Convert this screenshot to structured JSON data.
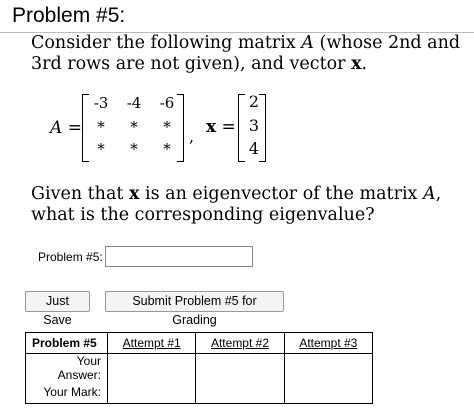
{
  "problem": {
    "title": "Problem #5:",
    "statement_part1": "Consider the following matrix ",
    "matrix_name": "A",
    "statement_part2": " (whose 2nd and 3rd rows are not given), and vector ",
    "vector_name": "x",
    "statement_end": ".",
    "question_part1": "Given that ",
    "question_vector": "x",
    "question_part2": " is an eigenvector of the matrix ",
    "question_matrix": "A",
    "question_part3": ", what is the corresponding eigenvalue?"
  },
  "math": {
    "lhs_name": "A",
    "equals": "=",
    "matrix": [
      [
        "-3",
        "-4",
        "-6"
      ],
      [
        "*",
        "*",
        "*"
      ],
      [
        "*",
        "*",
        "*"
      ]
    ],
    "comma": ",",
    "vector_label": "x",
    "vector": [
      "2",
      "3",
      "4"
    ]
  },
  "answer": {
    "label": "Problem #5:",
    "value": ""
  },
  "buttons": {
    "just_save": "Just Save",
    "submit": "Submit Problem #5 for Grading"
  },
  "attempts_table": {
    "header_label": "Problem #5",
    "attempts": [
      "Attempt #1",
      "Attempt #2",
      "Attempt #3"
    ],
    "row_labels": [
      "Your Answer:",
      "Your Mark:"
    ]
  }
}
